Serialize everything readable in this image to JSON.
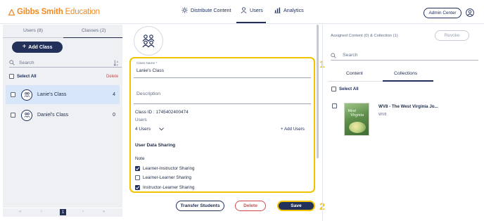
{
  "header": {
    "logo_brand": "Gibbs Smith",
    "logo_suffix": "Education",
    "nav": [
      {
        "label": "Distribute Content",
        "icon": "sun-icon"
      },
      {
        "label": "Users",
        "icon": "person-icon",
        "active": true
      },
      {
        "label": "Analytics",
        "icon": "bar-chart-icon"
      }
    ],
    "admin_label": "Admin Center"
  },
  "left": {
    "tabs": [
      {
        "label": "Users (8)"
      },
      {
        "label": "Classes (2)",
        "active": true
      }
    ],
    "add_class_label": "Add Class",
    "search_placeholder": "Search",
    "select_all": "Select All",
    "delete_label": "Delete",
    "classes": [
      {
        "name": "Lanie's Class",
        "count": "4",
        "selected": true
      },
      {
        "name": "Daniel's Class",
        "count": "0",
        "selected": false
      }
    ],
    "pager": {
      "current": "1",
      "first": "«",
      "prev": "‹",
      "next": "›",
      "last": "»"
    }
  },
  "middle": {
    "class_name_label": "Class Name *",
    "class_name_value": "Lanie's Class",
    "description_placeholder": "Description",
    "class_id": "Class ID : 1745402400474",
    "users_label": "Users",
    "users_count": "4 Users",
    "add_users": "+ Add Users",
    "data_sharing_title": "User Data Sharing",
    "note_label": "Note",
    "sharing": [
      {
        "label": "Learner-Instructor Sharing",
        "checked": true
      },
      {
        "label": "Learner-Learner Sharing",
        "checked": false
      },
      {
        "label": "Instructor-Learner Sharing",
        "checked": true
      }
    ],
    "callout_1": "1",
    "callout_2": "2",
    "buttons": {
      "transfer": "Transfer Students",
      "delete": "Delete",
      "save": "Save"
    }
  },
  "right": {
    "assigned": "Assigned Content (0) & Collection (1)",
    "revoke": "Revoke",
    "search_placeholder": "Search",
    "tabs": [
      {
        "label": "Content"
      },
      {
        "label": "Collections",
        "active": true
      }
    ],
    "select_all": "Select All",
    "collection": {
      "title": "WV8 - The West Virginia Jo...",
      "subtitle": "WV8",
      "cover_line1": "West",
      "cover_line2": "Virginia"
    }
  },
  "colors": {
    "navy": "#22305a",
    "highlight": "#f2c300",
    "danger": "#d24b4b",
    "brand_orange": "#f08a24",
    "selected_row": "#d8e6fa"
  }
}
